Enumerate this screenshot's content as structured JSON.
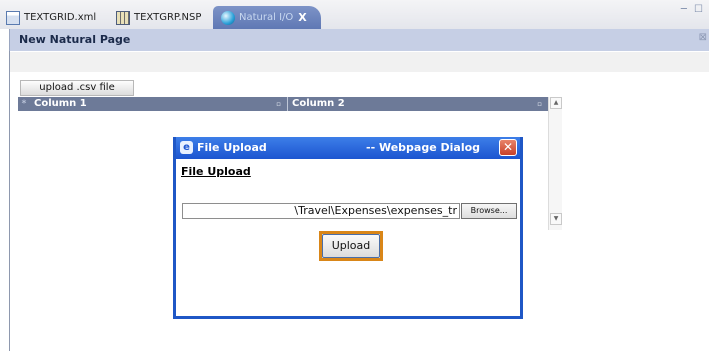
{
  "tabs": [
    {
      "label": "TEXTGRID.xml",
      "icon": "xml-file-icon"
    },
    {
      "label": "TEXTGRP.NSP",
      "icon": "nsp-file-icon"
    },
    {
      "label": "Natural I/O",
      "icon": "globe-icon",
      "active": true,
      "close": "X"
    }
  ],
  "window_controls": "─ ☐",
  "page": {
    "title": "New Natural Page",
    "close": "⊠",
    "upload_button": "upload .csv file"
  },
  "grid": {
    "corner": "*",
    "columns": [
      "Column 1",
      "Column 2"
    ],
    "sort_icon": "▫"
  },
  "dialog": {
    "title": "File Upload",
    "subtitle": "-- Webpage Dialog",
    "heading": "File Upload",
    "file_value": "\\Travel\\Expenses\\expenses_tr",
    "browse_label": "Browse...",
    "upload_label": "Upload",
    "close_glyph": "✕"
  },
  "colors": {
    "highlight": "#d98618",
    "dialog_title": "#1c55d0",
    "grid_header": "#6d7a98",
    "active_tab": "#6f86bd"
  }
}
